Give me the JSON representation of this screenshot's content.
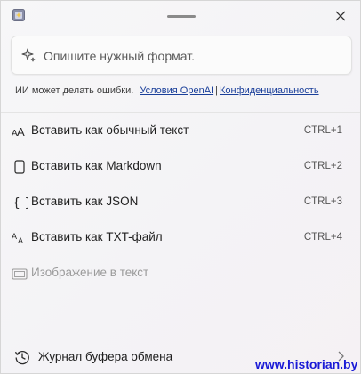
{
  "prompt": {
    "placeholder": "Опишите нужный формат."
  },
  "disclaimer": {
    "text": "ИИ может делать ошибки.",
    "terms_link": "Условия OpenAI",
    "separator": "|",
    "privacy_link": "Конфиденциальность"
  },
  "menu": [
    {
      "label": "Вставить как обычный текст",
      "shortcut": "CTRL+1",
      "icon": "text-aa-icon",
      "enabled": true
    },
    {
      "label": "Вставить как Markdown",
      "shortcut": "CTRL+2",
      "icon": "markdown-doc-icon",
      "enabled": true
    },
    {
      "label": "Вставить как JSON",
      "shortcut": "CTRL+3",
      "icon": "braces-icon",
      "enabled": true
    },
    {
      "label": "Вставить как TXT-файл",
      "shortcut": "CTRL+4",
      "icon": "txt-file-icon",
      "enabled": true
    },
    {
      "label": "Изображение в текст",
      "shortcut": "",
      "icon": "image-to-text-icon",
      "enabled": false
    }
  ],
  "history": {
    "label": "Журнал буфера обмена"
  },
  "watermark": "www.historian.by",
  "colors": {
    "link": "#1a3f9a",
    "watermark": "#1a1ad6",
    "disabled_text": "#9a9a9a"
  }
}
